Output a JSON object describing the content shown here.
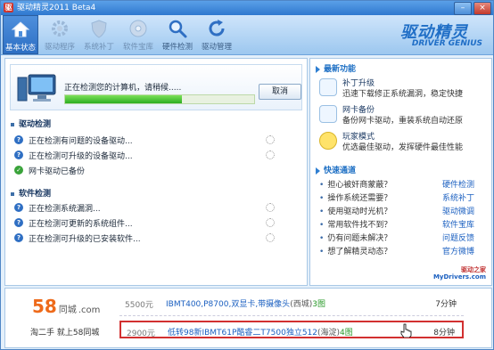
{
  "window": {
    "title": "驱动精灵2011 Beta4",
    "app_icon_glyph": "驱",
    "minimize_glyph": "–",
    "close_glyph": "×"
  },
  "toolbar": {
    "items": [
      {
        "label": "基本状态",
        "icon": "home-icon",
        "active": true
      },
      {
        "label": "驱动程序",
        "icon": "gear-icon",
        "dim": true
      },
      {
        "label": "系统补丁",
        "icon": "shield-icon",
        "dim": true
      },
      {
        "label": "软件宝库",
        "icon": "disc-icon",
        "dim": true
      },
      {
        "label": "硬件检测",
        "icon": "magnifier-icon"
      },
      {
        "label": "驱动管理",
        "icon": "refresh-icon"
      }
    ],
    "logo_title": "驱动精灵",
    "logo_sub": "DRIVER GENIUS"
  },
  "scan": {
    "message": "正在检测您的计算机，请稍候.....",
    "progress": 0.62,
    "cancel_label": "取消"
  },
  "driver_section": {
    "title": "驱动检测",
    "rows": [
      {
        "text": "正在检测有问题的设备驱动...",
        "status": "scanning"
      },
      {
        "text": "正在检测可升级的设备驱动...",
        "status": "scanning"
      },
      {
        "text": "网卡驱动已备份",
        "status": "done"
      }
    ]
  },
  "software_section": {
    "title": "软件检测",
    "rows": [
      {
        "text": "正在检测系统漏洞...",
        "status": "scanning"
      },
      {
        "text": "正在检测可更新的系统组件...",
        "status": "scanning"
      },
      {
        "text": "正在检测可升级的已安装软件...",
        "status": "scanning"
      }
    ]
  },
  "new_features": {
    "title": "最新功能",
    "items": [
      {
        "name": "补丁升级",
        "desc": "迅速下载修正系统漏洞，稳定快捷",
        "icon": "patch-icon"
      },
      {
        "name": "网卡备份",
        "desc": "备份网卡驱动，重装系统自动还原",
        "icon": "network-card-icon"
      },
      {
        "name": "玩家模式",
        "desc": "优选最佳驱动，发挥硬件最佳性能",
        "icon": "smiley-icon"
      }
    ]
  },
  "quick_links": {
    "title": "快速通道",
    "items": [
      {
        "question": "担心被奸商蒙蔽？",
        "link": "硬件检测"
      },
      {
        "question": "操作系统还需要？",
        "link": "系统补丁"
      },
      {
        "question": "使用驱动时光机？",
        "link": "驱动微调"
      },
      {
        "question": "常用软件找不到？",
        "link": "软件宝库"
      },
      {
        "question": "仍有问题未解决？",
        "link": "问题反馈"
      },
      {
        "question": "想了解精灵动态？",
        "link": "官方微博"
      }
    ]
  },
  "mydrivers": {
    "line1": "驱动之家",
    "line2": "MyDrivers.com"
  },
  "ad": {
    "logo": "58",
    "logo_suffix": "同城",
    "logo_domain": ".com",
    "slogan": "淘二手 就上58同城",
    "rows": [
      {
        "price": "5500元",
        "desc": "IBMT400,P8700,双显卡,带摄像头",
        "area": "(西城)",
        "pics": "3图",
        "time": "7分钟",
        "highlight": false
      },
      {
        "price": "2900元",
        "desc": "低转98新IBMT61P酷睿二T7500独立512",
        "area": "(海淀)",
        "pics": "4图",
        "time": "8分钟",
        "highlight": true
      }
    ]
  }
}
